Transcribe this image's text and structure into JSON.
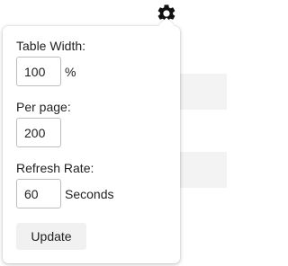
{
  "settings": {
    "gear_icon": "gear-icon",
    "table_width": {
      "label": "Table Width:",
      "value": "100",
      "unit": "%"
    },
    "per_page": {
      "label": "Per page:",
      "value": "200"
    },
    "refresh_rate": {
      "label": "Refresh Rate:",
      "value": "60",
      "unit": "Seconds"
    },
    "update_label": "Update"
  }
}
